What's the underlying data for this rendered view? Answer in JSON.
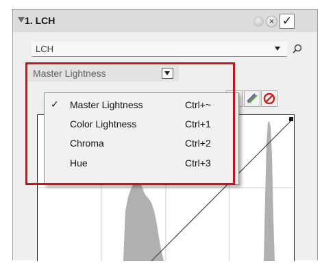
{
  "header": {
    "title": "1. LCH",
    "close_glyph": "×",
    "enabled_glyph": "✓"
  },
  "mode_select": {
    "value": "LCH"
  },
  "channel_select": {
    "value": "Master Lightness"
  },
  "menu": {
    "items": [
      {
        "check": "✓",
        "label": "Master Lightness",
        "shortcut": "Ctrl+~"
      },
      {
        "check": "",
        "label": "Color Lightness",
        "shortcut": "Ctrl+1"
      },
      {
        "check": "",
        "label": "Chroma",
        "shortcut": "Ctrl+2"
      },
      {
        "check": "",
        "label": "Hue",
        "shortcut": "Ctrl+3"
      }
    ]
  },
  "icons": {
    "collapse": "triangle-down-icon",
    "reset_panel": "circle-icon",
    "close": "close-icon",
    "enable": "checkbox-icon",
    "picker": "eyedropper-icon",
    "linear": "diagonal-line-icon",
    "color": "color-pencil-icon",
    "reset": "no-sign-icon"
  },
  "colors": {
    "highlight": "#d01018",
    "reset_red": "#d32020",
    "histogram": "#b0b0b0"
  }
}
